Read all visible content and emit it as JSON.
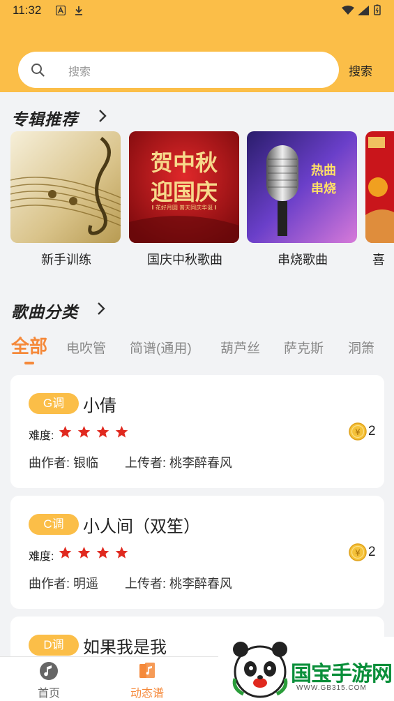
{
  "status_bar": {
    "time": "11:32"
  },
  "search": {
    "placeholder": "搜索",
    "button_label": "搜索"
  },
  "albums_section": {
    "title": "专辑推荐",
    "albums": [
      {
        "name": "新手训练"
      },
      {
        "name": "国庆中秋歌曲",
        "cover_text_line1": "贺中秋",
        "cover_text_line2": "迎国庆",
        "cover_small_text": "‖ 花好月圆 普天同庆华诞 ‖"
      },
      {
        "name": "串烧歌曲",
        "cover_text_line1": "热曲",
        "cover_text_line2": "串烧"
      },
      {
        "name": "喜"
      }
    ]
  },
  "category_section": {
    "title": "歌曲分类",
    "tabs": [
      "全部",
      "电吹管",
      "简谱(通用)",
      "葫芦丝",
      "萨克斯",
      "洞箫"
    ],
    "active_tab": 0
  },
  "songs": [
    {
      "key": "G调",
      "title": "小倩",
      "difficulty_label": "难度:",
      "stars": 4,
      "coins": "2",
      "composer": "曲作者: 银临",
      "uploader": "上传者: 桃李醉春风"
    },
    {
      "key": "C调",
      "title": "小人间（双笙）",
      "difficulty_label": "难度:",
      "stars": 4,
      "coins": "2",
      "composer": "曲作者: 明遥",
      "uploader": "上传者: 桃李醉春风"
    },
    {
      "key": "D调",
      "title": "如果我是我"
    }
  ],
  "bottom_nav": {
    "items": [
      {
        "label": "首页",
        "icon": "music-note-icon"
      },
      {
        "label": "动态谱",
        "icon": "sheet-music-icon"
      }
    ],
    "active": 1
  },
  "watermark": {
    "brand": "国宝手游网",
    "url": "WWW.GB315.COM"
  },
  "colors": {
    "accent": "#fbbe48",
    "active_tab": "#f5893a",
    "star": "#e0291f"
  }
}
